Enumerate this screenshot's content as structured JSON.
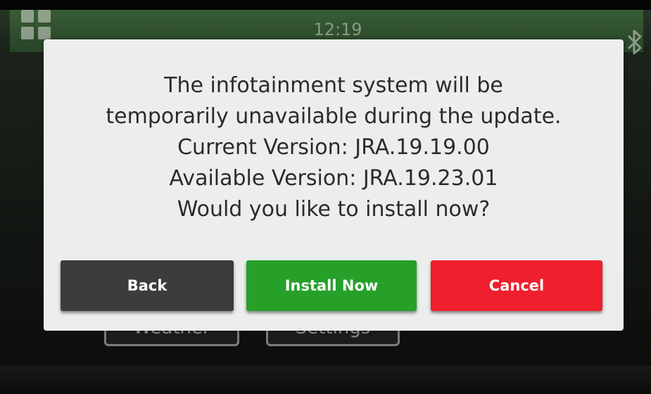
{
  "status_bar": {
    "time": "12:19",
    "apps_icon": "grid-apps-icon",
    "bluetooth_icon": "bluetooth-icon"
  },
  "background_tiles": {
    "weather_label": "Weather",
    "settings_label": "Settings"
  },
  "dialog": {
    "lines": [
      "The infotainment system will be",
      "temporarily unavailable during the update.",
      "Current Version: JRA.19.19.00",
      "Available Version: JRA.19.23.01",
      "Would you like to install now?"
    ],
    "buttons": {
      "back": "Back",
      "install": "Install Now",
      "cancel": "Cancel"
    }
  },
  "colors": {
    "back_button": "#3b3d3c",
    "install_button": "#27a02a",
    "cancel_button": "#ef1f2e",
    "dialog_background": "#eceeed"
  }
}
